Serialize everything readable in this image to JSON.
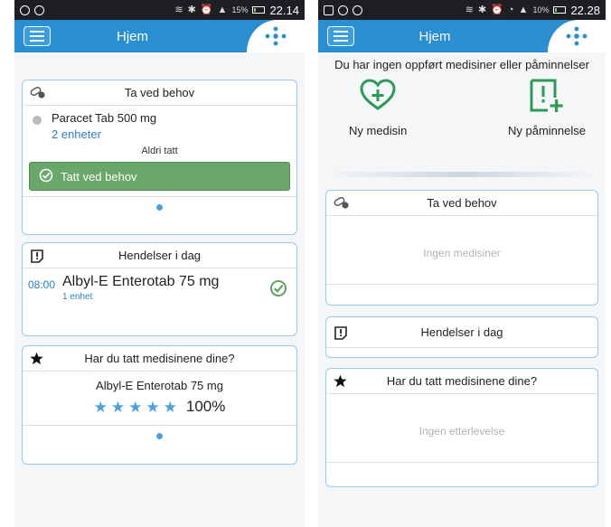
{
  "left": {
    "status": {
      "battery": "15%",
      "time": "22.14"
    },
    "appbar": {
      "title": "Hjem"
    },
    "as_needed": {
      "title": "Ta ved behov",
      "medicine": {
        "name": "Paracet Tab 500 mg",
        "units": "2 enheter",
        "status": "Aldri tatt"
      },
      "button_label": "Tatt ved behov"
    },
    "events": {
      "title": "Hendelser i dag",
      "items": [
        {
          "time": "08:00",
          "name": "Albyl-E Enterotab 75 mg",
          "units": "1 enhet",
          "done": true
        }
      ]
    },
    "adherence": {
      "title": "Har du tatt medisinene dine?",
      "medicine": "Albyl-E Enterotab 75 mg",
      "stars": 5,
      "stars_max": 5,
      "percent": "100%"
    }
  },
  "right": {
    "status": {
      "battery": "10%",
      "time": "22.28"
    },
    "appbar": {
      "title": "Hjem"
    },
    "no_items_message": "Du har ingen oppført medisiner eller påminnelser",
    "actions": {
      "new_medicine": "Ny medisin",
      "new_reminder": "Ny påminnelse"
    },
    "as_needed": {
      "title": "Ta ved behov",
      "empty": "Ingen medisiner"
    },
    "events": {
      "title": "Hendelser i dag"
    },
    "adherence": {
      "title": "Har du tatt medisinene dine?",
      "empty": "Ingen etterlevelse"
    }
  },
  "colors": {
    "appbar": "#2a8fd0",
    "card_border": "#9cc8ea",
    "accent_blue": "#2a7fc7",
    "taken_green": "#6aa869",
    "check_green": "#5aa35a",
    "star_blue": "#4a9fde"
  },
  "icons": {
    "menu": "hamburger-icon",
    "dots": "dots-cross-icon",
    "pills": "pills-icon",
    "event": "exclamation-note-icon",
    "star": "star-icon",
    "check": "check-circle-icon",
    "heart_plus": "heart-plus-icon",
    "note_plus": "note-exclamation-plus-icon"
  }
}
